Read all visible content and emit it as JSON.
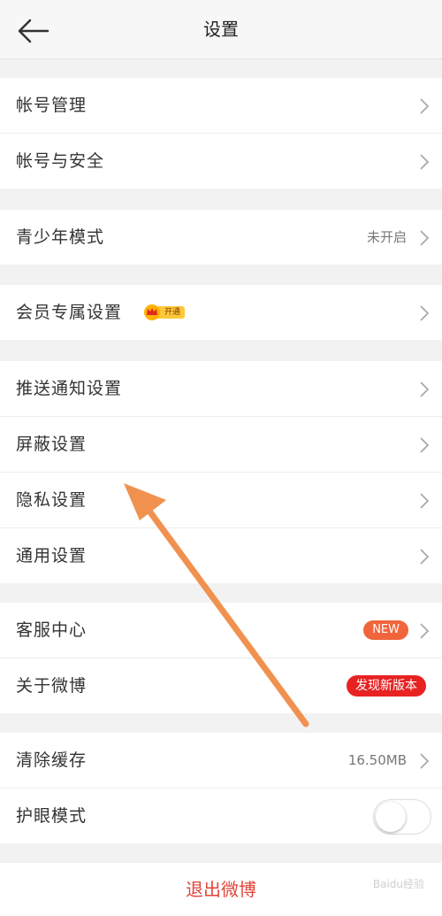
{
  "header": {
    "title": "设置"
  },
  "groups": {
    "account": {
      "manage": "帐号管理",
      "security": "帐号与安全"
    },
    "youth": {
      "label": "青少年模式",
      "value": "未开启"
    },
    "vip": {
      "label": "会员专属设置",
      "badge": "开通"
    },
    "settings": {
      "push": "推送通知设置",
      "block": "屏蔽设置",
      "privacy": "隐私设置",
      "general": "通用设置"
    },
    "support": {
      "service": "客服中心",
      "service_badge": "NEW",
      "about": "关于微博",
      "about_badge": "发现新版本"
    },
    "storage": {
      "cache": "清除缓存",
      "cache_value": "16.50MB",
      "eye": "护眼模式",
      "eye_on": false
    }
  },
  "logout": "退出微博",
  "colors": {
    "accent_red": "#e0453a",
    "new_badge": "#f0653c",
    "version_badge": "#e82222",
    "annotation_arrow": "#f0914f"
  },
  "watermark": "Baidu经验"
}
